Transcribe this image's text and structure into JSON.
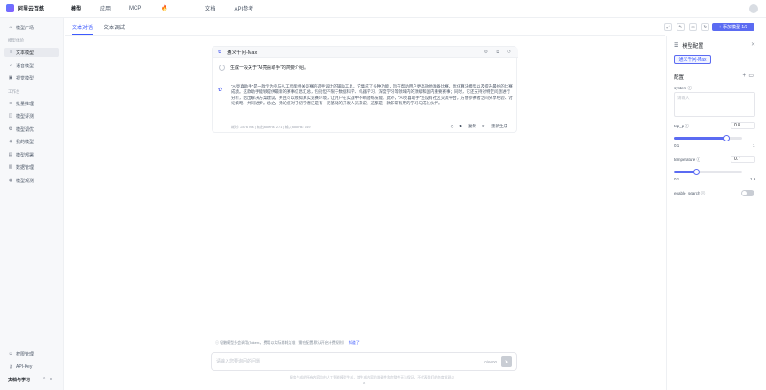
{
  "topbar": {
    "logo": "阿里云百炼",
    "nav": [
      "模型",
      "应用",
      "MCP",
      "文档",
      "API参考"
    ],
    "mcp_badge": "🔥"
  },
  "sidebar": {
    "plaza": "模型广场",
    "section_experience": "模型体验",
    "items_experience": [
      "文本模型",
      "语音模型",
      "视觉模型"
    ],
    "section_tools": "工作台",
    "items_tools": [
      "批量推理",
      "模型评测",
      "模型调优",
      "我的模型",
      "模型部署",
      "数据管理",
      "模型观测"
    ],
    "footer_items": [
      "权限管理",
      "API-Key"
    ],
    "footer_label": "文档与学习"
  },
  "main": {
    "tabs": [
      "文本对话",
      "文本调试"
    ],
    "add_model": "+ 添加模型 1/3",
    "card": {
      "model_name": "通义千问-Max",
      "user_message": "生成一段关于“AI亮喜助手”的简要介绍。",
      "reply": "“AI亮喜助手”是一款专为参与人工智能相关竞赛的选手设计的辅助工具，它集成了多种功能，旨在帮助用户更高效地准备比赛、优化算法模型以及提升最终的比赛成绩。这款助手能够提供最新的赛事信息汇总，包括但不限于数据科学、机器学习、深度学习等领域内的顶级和国内重要赛事；同时，它还支持对特定问题进行分析，给出解决方案建议，并且可以模拟真实竞赛环境，让用户在实战中不断磨练技能。此外，“AI亮喜助手”还设有社区交流平台，方便参赛者之间分享经验、讨论策略、共同进步。总之，无论您对于初学者还是有一定基础的开发人员来说，这都是一款非常有用的学习与成长伙伴。",
      "meta": "耗时: 2876 ms | 输出tokens: 271 | 输入tokens: 149",
      "actions": [
        "复制",
        "重新生成"
      ]
    },
    "notice": "轻触模型多会调用(Token)，费用以实际消耗为准（需在配置-默认开启计费规则）",
    "notice_link": "知道了",
    "input_placeholder": "请输入您要询问的问题",
    "counter": "0/6000",
    "disclaimer": "服务生成的所有内容均由人工智能模型生成，其生成内容的准确性和完整性无法保证，不代表我们的态度或观点"
  },
  "panel": {
    "title": "模型配置",
    "model_chip": "通义千问-Max",
    "config_label": "配置",
    "system_label": "system",
    "system_placeholder": "请输入",
    "top_p_label": "top_p",
    "top_p": 0.8,
    "top_p_range": [
      "0.1",
      "1"
    ],
    "temperature_label": "temperature",
    "temperature": 0.7,
    "temperature_range": [
      "0.1",
      "1.9"
    ],
    "search_label": "enable_search"
  }
}
